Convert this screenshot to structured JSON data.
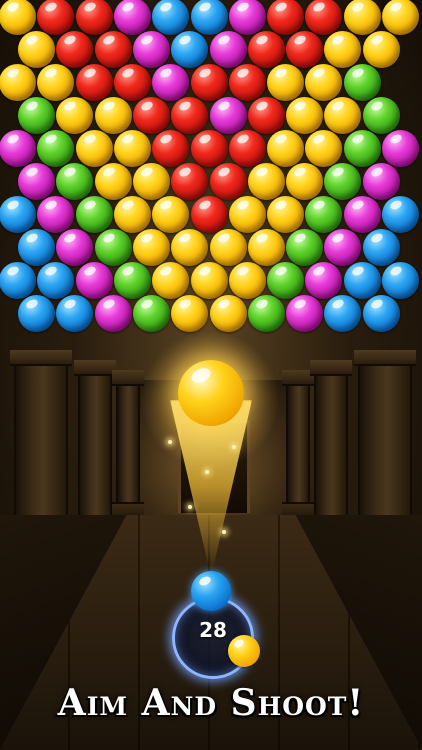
{
  "game": {
    "tagline": "Aim And Shoot!",
    "shots_remaining": "28",
    "current_bubble_color": "blue",
    "next_bubble_color": "yellow",
    "shot_bubble_color": "yellow"
  },
  "bubble_colors": {
    "Y": "#ffd21a",
    "R": "#e8201a",
    "P": "#e23ad3",
    "B": "#1e9cf0",
    "G": "#52c72a"
  },
  "bubble_rows": [
    "YRRPBBPRRYY",
    "YRRPBPRRYY",
    "YYRRPRRYYG",
    "GYYRRPRYYG",
    "PGYYRRRYYGP",
    "PGYYRRYYGP",
    "BPGYYRYYGPB",
    "BPGYYYYGPB",
    "BBPGYYYGPBB",
    "BBPGYYGPBB"
  ]
}
